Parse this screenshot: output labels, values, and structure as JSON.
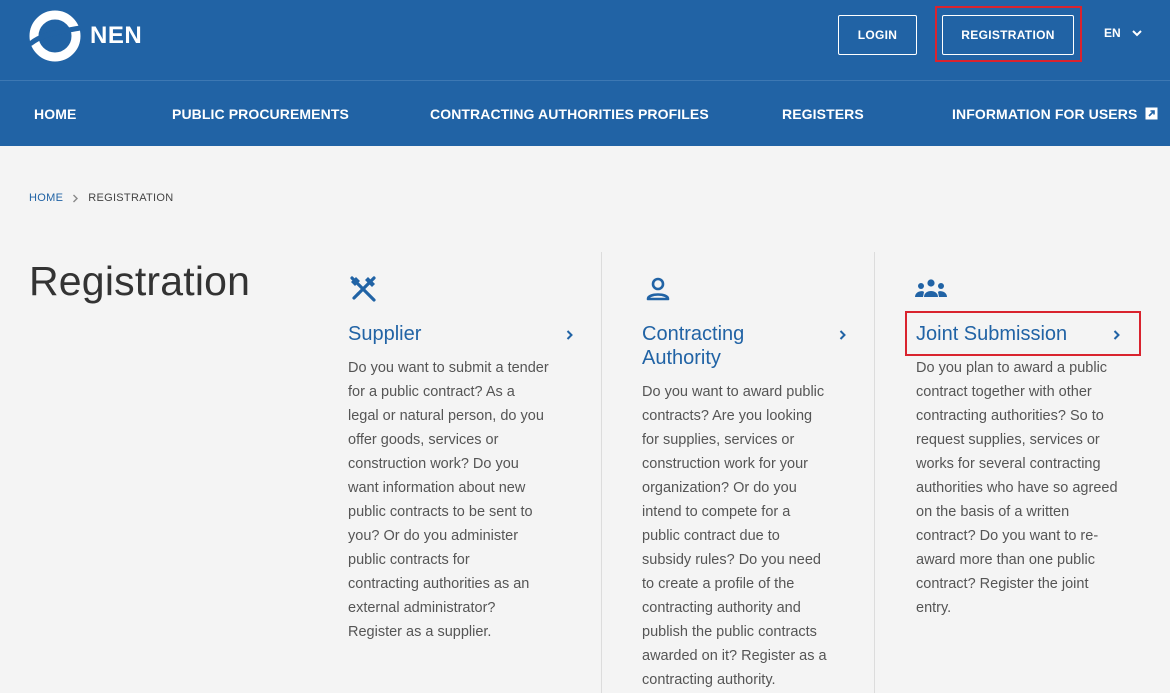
{
  "brand": {
    "name": "NEN"
  },
  "header": {
    "login_label": "LOGIN",
    "registration_label": "REGISTRATION",
    "language": "EN"
  },
  "nav": {
    "items": [
      {
        "label": "HOME"
      },
      {
        "label": "PUBLIC PROCUREMENTS"
      },
      {
        "label": "CONTRACTING AUTHORITIES PROFILES"
      },
      {
        "label": "REGISTERS"
      },
      {
        "label": "INFORMATION FOR USERS"
      }
    ]
  },
  "breadcrumb": {
    "home": "HOME",
    "current": "REGISTRATION"
  },
  "page": {
    "title": "Registration"
  },
  "cards": [
    {
      "icon": "tools-icon",
      "title": "Supplier",
      "lines": [
        "Do you want to submit a tender",
        "for a public contract? As a",
        "legal or natural person, do you",
        "offer goods, services or",
        "construction work? Do you",
        "want information about new",
        "public contracts to be sent to",
        "you? Or do you administer",
        "public contracts for",
        "contracting authorities as an",
        "external administrator?",
        "Register as a supplier."
      ]
    },
    {
      "icon": "user-icon",
      "title_lines": [
        "Contracting",
        "Authority"
      ],
      "lines": [
        "Do you want to award public",
        "contracts? Are you looking",
        "for supplies, services or",
        "construction work for your",
        "organization? Or do you",
        "intend to compete for a",
        "public contract due to",
        "subsidy rules? Do you need",
        "to create a profile of the",
        "contracting authority and",
        "publish the public contracts",
        "awarded on it? Register as a",
        "contracting authority."
      ]
    },
    {
      "icon": "group-icon",
      "title": "Joint Submission",
      "lines": [
        "Do you plan to award a public",
        "contract together with other",
        "contracting authorities? So to",
        "request supplies, services or",
        "works for several contracting",
        "authorities who have so agreed",
        "on the basis of a written",
        "contract? Do you want to re-",
        "award more than one public",
        "contract? Register the joint",
        "entry."
      ]
    }
  ],
  "colors": {
    "primary": "#2163a5",
    "highlight": "#d9232e",
    "background": "#f4f4f4"
  }
}
